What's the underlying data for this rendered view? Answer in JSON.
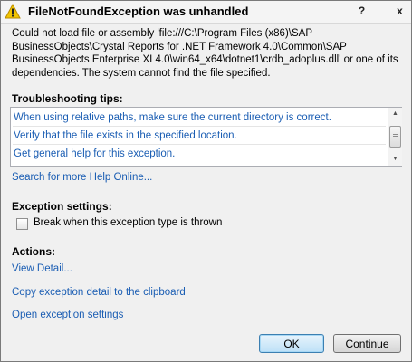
{
  "title_bar": {
    "title": "FileNotFoundException was unhandled",
    "help_glyph": "?",
    "close_glyph": "x",
    "icon": "warning-icon"
  },
  "message": "Could not load file or assembly 'file:///C:\\Program Files (x86)\\SAP BusinessObjects\\Crystal Reports for .NET Framework 4.0\\Common\\SAP BusinessObjects Enterprise XI 4.0\\win64_x64\\dotnet1\\crdb_adoplus.dll' or one of its dependencies. The system cannot find the file specified.",
  "troubleshooting": {
    "heading": "Troubleshooting tips:",
    "tips": [
      "When using relative paths, make sure the current directory is correct.",
      "Verify that the file exists in the specified location.",
      "Get general help for this exception."
    ],
    "search_link": "Search for more Help Online..."
  },
  "exception_settings": {
    "heading": "Exception settings:",
    "checkbox_label": "Break when this exception type is thrown",
    "checked": false
  },
  "actions": {
    "heading": "Actions:",
    "links": [
      "View Detail...",
      "Copy exception detail to the clipboard",
      "Open exception settings"
    ]
  },
  "buttons": {
    "ok": "OK",
    "continue": "Continue"
  },
  "colors": {
    "link": "#1a5db3",
    "warning_fill": "#f2c500"
  }
}
